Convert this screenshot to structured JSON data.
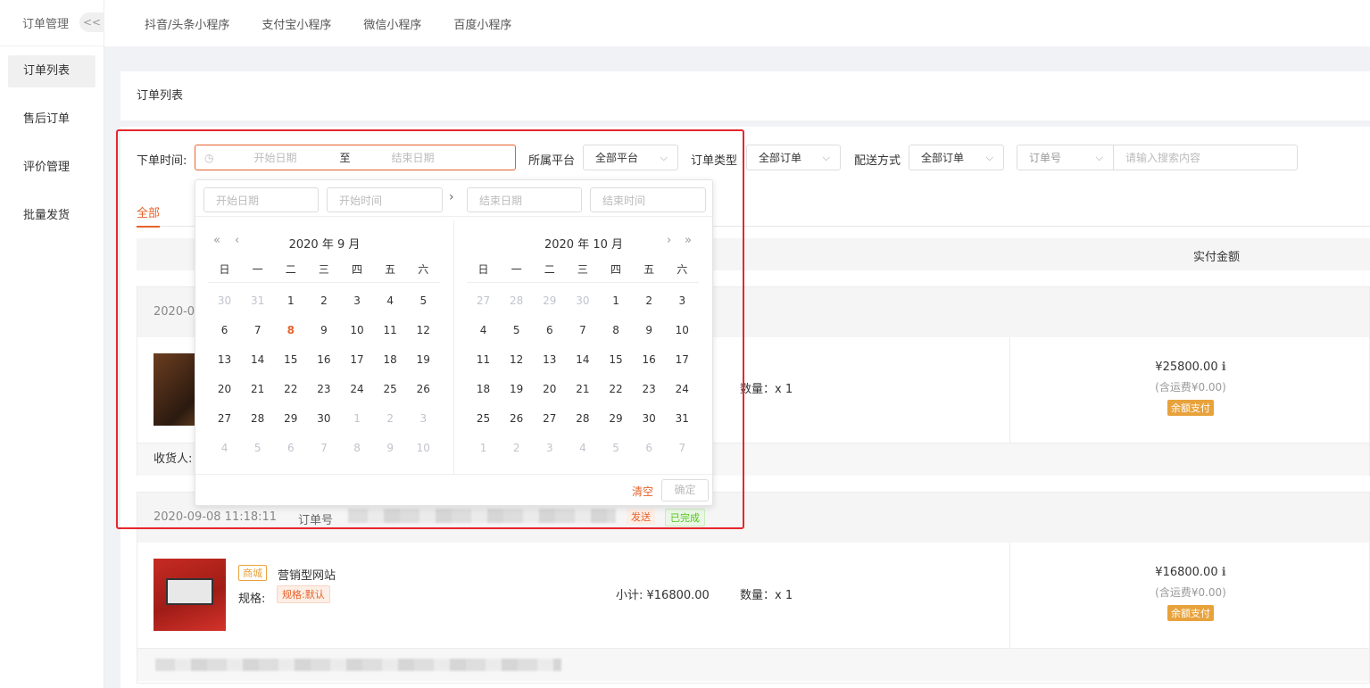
{
  "sidebar": {
    "header": "订单管理",
    "collapse_label": "<<",
    "items": [
      {
        "label": "订单列表"
      },
      {
        "label": "售后订单"
      },
      {
        "label": "评价管理"
      },
      {
        "label": "批量发货"
      }
    ]
  },
  "topbar": {
    "tabs": [
      "抖音/头条小程序",
      "支付宝小程序",
      "微信小程序",
      "百度小程序"
    ]
  },
  "page_title": "订单列表",
  "filters": {
    "order_time_label": "下单时间:",
    "start_placeholder": "开始日期",
    "range_sep": "至",
    "end_placeholder": "结束日期",
    "platform_label": "所属平台",
    "platform_value": "全部平台",
    "order_type_label": "订单类型",
    "order_type_value": "全部订单",
    "delivery_label": "配送方式",
    "delivery_value": "全部订单",
    "search_field": "订单号",
    "search_placeholder": "请输入搜索内容"
  },
  "order_tabs": [
    "全部"
  ],
  "table_header": {
    "paid_amount": "实付金额"
  },
  "orders": [
    {
      "time": "2020-0",
      "price": "¥25800.00",
      "freight": "(含运费¥0.00)",
      "pay": "余额支付",
      "quantity": "数量：x 1",
      "receiver_label": "收货人:"
    },
    {
      "time": "2020-09-08 11:18:11",
      "number_label": "订单号",
      "status_ship": "发送",
      "status_done": "已完成",
      "shop_tag": "商城",
      "product": "营销型网站",
      "spec_label": "规格:",
      "spec_value": "规格:默认",
      "subtotal": "小计: ¥16800.00",
      "quantity": "数量：x 1",
      "price": "¥16800.00",
      "freight": "(含运费¥0.00)",
      "pay": "余额支付"
    }
  ],
  "picker": {
    "start_date": "开始日期",
    "start_time": "开始时间",
    "end_date": "结束日期",
    "end_time": "结束时间",
    "left_title": "2020 年 9 月",
    "right_title": "2020 年 10 月",
    "weekdays": [
      "日",
      "一",
      "二",
      "三",
      "四",
      "五",
      "六"
    ],
    "left_days": [
      [
        "30",
        "31",
        "1",
        "2",
        "3",
        "4",
        "5"
      ],
      [
        "6",
        "7",
        "8",
        "9",
        "10",
        "11",
        "12"
      ],
      [
        "13",
        "14",
        "15",
        "16",
        "17",
        "18",
        "19"
      ],
      [
        "20",
        "21",
        "22",
        "23",
        "24",
        "25",
        "26"
      ],
      [
        "27",
        "28",
        "29",
        "30",
        "1",
        "2",
        "3"
      ],
      [
        "4",
        "5",
        "6",
        "7",
        "8",
        "9",
        "10"
      ]
    ],
    "right_days": [
      [
        "27",
        "28",
        "29",
        "30",
        "1",
        "2",
        "3"
      ],
      [
        "4",
        "5",
        "6",
        "7",
        "8",
        "9",
        "10"
      ],
      [
        "11",
        "12",
        "13",
        "14",
        "15",
        "16",
        "17"
      ],
      [
        "18",
        "19",
        "20",
        "21",
        "22",
        "23",
        "24"
      ],
      [
        "25",
        "26",
        "27",
        "28",
        "29",
        "30",
        "31"
      ],
      [
        "1",
        "2",
        "3",
        "4",
        "5",
        "6",
        "7"
      ]
    ],
    "clear": "清空",
    "confirm": "确定"
  },
  "colors": {
    "accent": "#e6622a",
    "highlight": "#e5262e",
    "pay_badge": "#e8a23c"
  }
}
